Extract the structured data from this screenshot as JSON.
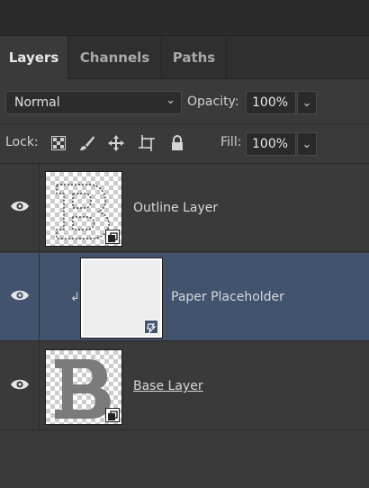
{
  "tabs": [
    {
      "label": "Layers",
      "active": true
    },
    {
      "label": "Channels",
      "active": false
    },
    {
      "label": "Paths",
      "active": false
    }
  ],
  "blend": {
    "mode": "Normal",
    "opacity_label": "Opacity:",
    "opacity_value": "100%"
  },
  "lock": {
    "label": "Lock:",
    "icons": [
      "transparency-lock-icon",
      "brush-icon",
      "move-icon",
      "artboard-icon",
      "padlock-icon"
    ]
  },
  "fill": {
    "label": "Fill:",
    "value": "100%"
  },
  "layers": [
    {
      "name": "Outline Layer",
      "visible": true,
      "selected": false,
      "thumbnail": "outline-b",
      "smart_object": true
    },
    {
      "name": "Paper Placeholder",
      "visible": true,
      "selected": true,
      "thumbnail": "paper",
      "clipped": true,
      "linked_smart_object": true
    },
    {
      "name": "Base Layer",
      "visible": true,
      "selected": false,
      "thumbnail": "solid-b",
      "smart_object": true
    }
  ],
  "colors": {
    "selected_row": "#42536e",
    "panel_bg": "#3a3a3a"
  }
}
